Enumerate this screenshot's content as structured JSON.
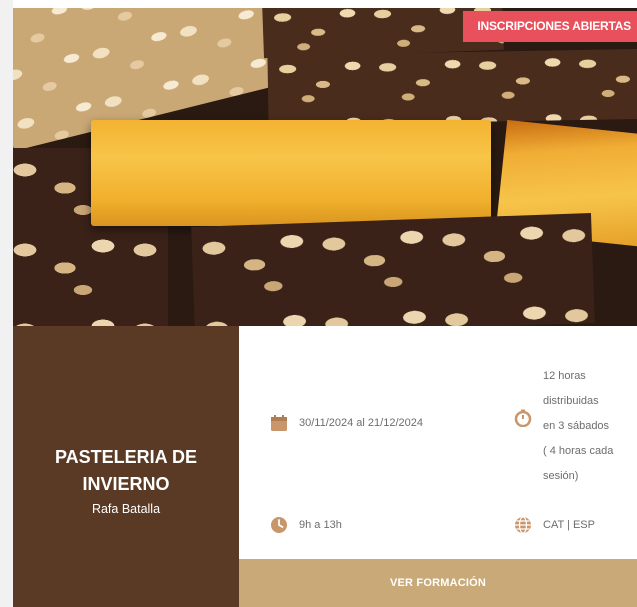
{
  "badge": {
    "label": "INSCRIPCIONES ABIERTAS"
  },
  "course": {
    "title": "PASTELERIA DE INVIERNO",
    "instructor": "Rafa Batalla"
  },
  "details": {
    "dates": {
      "icon": "calendar-icon",
      "text": "30/11/2024 al 21/12/2024"
    },
    "duration": {
      "icon": "timer-icon",
      "text": "12 horas\ndistribuidas\nen 3 sábados\n( 4 horas cada\nsesión)"
    },
    "schedule": {
      "icon": "clock-icon",
      "text": "9h a 13h"
    },
    "language": {
      "icon": "globe-icon",
      "text": "CAT | ESP"
    }
  },
  "cta": {
    "label": "VER FORMACIÓN"
  },
  "colors": {
    "badge": "#e8505b",
    "left_panel": "#5a3a24",
    "cta": "#c9a977",
    "icon_accent": "#c9956a"
  }
}
